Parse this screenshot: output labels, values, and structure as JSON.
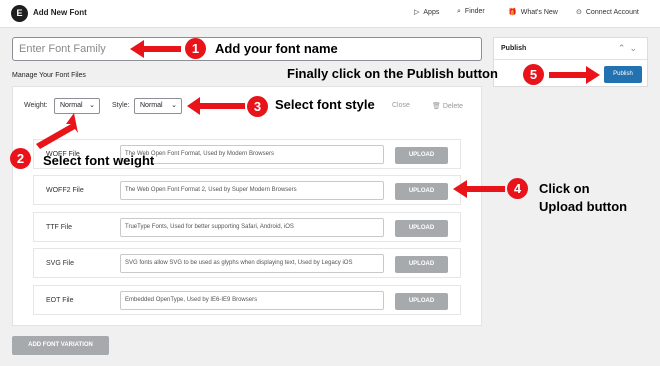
{
  "header": {
    "logo_letter": "E",
    "title": "Add New Font",
    "nav": [
      {
        "icon": "apps-icon",
        "label": "Apps"
      },
      {
        "icon": "search-icon",
        "label": "Finder"
      },
      {
        "icon": "gift-icon",
        "label": "What's New"
      },
      {
        "icon": "link-icon",
        "label": "Connect Account"
      }
    ]
  },
  "font_family": {
    "placeholder": "Enter Font Family",
    "value": ""
  },
  "manage_title": "Manage Your Font Files",
  "variation": {
    "weight_label": "Weight:",
    "weight_value": "Normal",
    "style_label": "Style:",
    "style_value": "Normal",
    "close_label": "Close",
    "delete_label": "Delete"
  },
  "files": [
    {
      "label": "WOFF File",
      "description": "The Web Open Font Format, Used by Modern Browsers",
      "button": "UPLOAD"
    },
    {
      "label": "WOFF2 File",
      "description": "The Web Open Font Format 2, Used by Super Modern Browsers",
      "button": "UPLOAD"
    },
    {
      "label": "TTF File",
      "description": "TrueType Fonts, Used for better supporting Safari, Android, iOS",
      "button": "UPLOAD"
    },
    {
      "label": "SVG File",
      "description": "SVG fonts allow SVG to be used as glyphs when displaying text, Used by Legacy iOS",
      "button": "UPLOAD"
    },
    {
      "label": "EOT File",
      "description": "Embedded OpenType, Used by IE6-IE9 Browsers",
      "button": "UPLOAD"
    }
  ],
  "add_variation_label": "ADD FONT VARIATION",
  "publish": {
    "title": "Publish",
    "button": "Publish"
  },
  "annotations": {
    "accent_color": "#e8141a",
    "steps": [
      {
        "number": "1",
        "text": "Add your font name"
      },
      {
        "number": "2",
        "text": "Select font weight"
      },
      {
        "number": "3",
        "text": "Select font style"
      },
      {
        "number": "4",
        "text": "Click on Upload button"
      },
      {
        "number": "5",
        "text": "Finally click on the Publish button"
      }
    ],
    "step4_line1": "Click on",
    "step4_line2": "Upload button"
  }
}
